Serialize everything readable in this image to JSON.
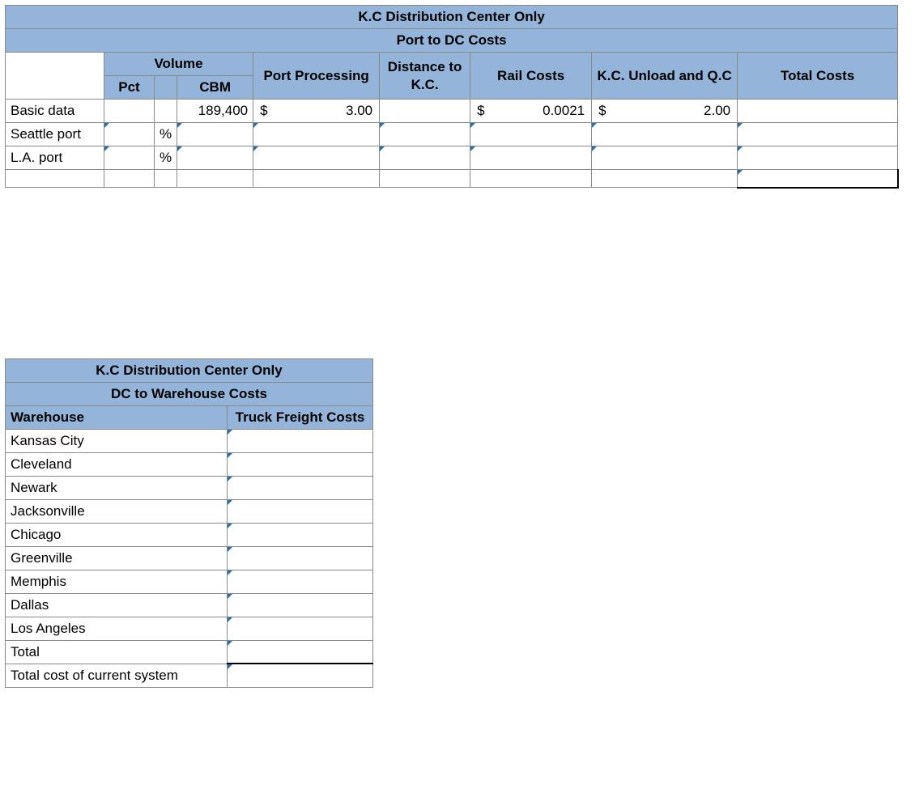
{
  "top": {
    "title": "K.C Distribution Center Only",
    "subtitle": "Port to DC Costs",
    "headers": {
      "volume": "Volume",
      "pct": "Pct",
      "cbm": "CBM",
      "port_processing": "Port Processing",
      "distance": "Distance to K.C.",
      "rail": "Rail Costs",
      "unload": "K.C. Unload and Q.C",
      "total": "Total Costs"
    },
    "rows": {
      "basic": {
        "label": "Basic data",
        "pct": "",
        "pct_unit": "",
        "cbm": "189,400",
        "port_processing_sym": "$",
        "port_processing_val": "3.00",
        "distance": "",
        "rail_sym": "$",
        "rail_val": "0.0021",
        "unload_sym": "$",
        "unload_val": "2.00",
        "total": ""
      },
      "seattle": {
        "label": "Seattle port",
        "pct_unit": "%"
      },
      "la": {
        "label": "L.A. port",
        "pct_unit": "%"
      }
    }
  },
  "bottom": {
    "title": "K.C Distribution Center Only",
    "subtitle": "DC to Warehouse Costs",
    "headers": {
      "warehouse": "Warehouse",
      "truck": "Truck Freight Costs"
    },
    "rows": [
      "Kansas City",
      "Cleveland",
      "Newark",
      "Jacksonville",
      "Chicago",
      "Greenville",
      "Memphis",
      "Dallas",
      "Los Angeles",
      "Total",
      "Total cost of current system"
    ]
  }
}
